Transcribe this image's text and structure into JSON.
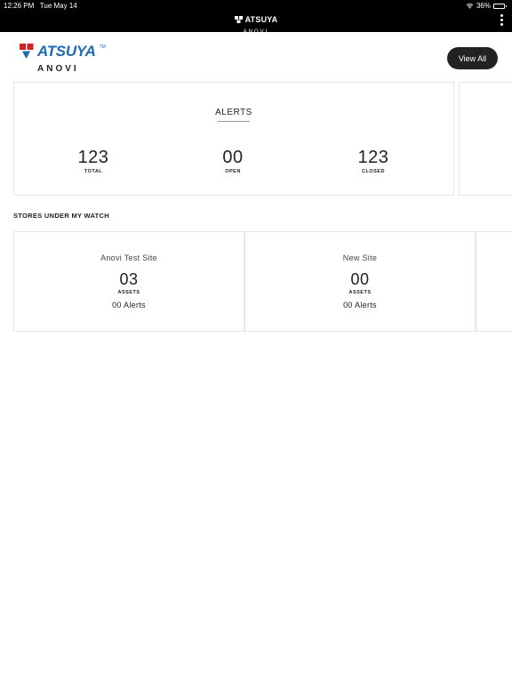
{
  "status_bar": {
    "time": "12:26 PM",
    "date": "Tue May 14",
    "battery": "36%",
    "battery_level": 0.36
  },
  "top_bar": {
    "brand": "ATSUYA",
    "sub": "ANOVI"
  },
  "header": {
    "brand": "ATSUYA",
    "trademark": "TM",
    "sub": "ANOVI",
    "view_all_label": "View All"
  },
  "alerts": {
    "title": "ALERTS",
    "total": {
      "value": "123",
      "label": "TOTAL"
    },
    "open": {
      "value": "00",
      "label": "OPEN"
    },
    "closed": {
      "value": "123",
      "label": "CLOSED"
    }
  },
  "stores_section": {
    "title": "STORES UNDER MY WATCH",
    "stores": [
      {
        "name": "Anovi Test Site",
        "assets": "03",
        "assets_label": "ASSETS",
        "alerts": "00 Alerts"
      },
      {
        "name": "New Site",
        "assets": "00",
        "assets_label": "ASSETS",
        "alerts": "00 Alerts"
      }
    ]
  },
  "colors": {
    "brand_blue": "#1d69b6",
    "brand_red": "#d32027",
    "topbar": "#000000",
    "button": "#222222"
  },
  "icons": [
    "wifi-icon",
    "battery-icon",
    "kebab-menu-icon",
    "atsuya-logo"
  ]
}
